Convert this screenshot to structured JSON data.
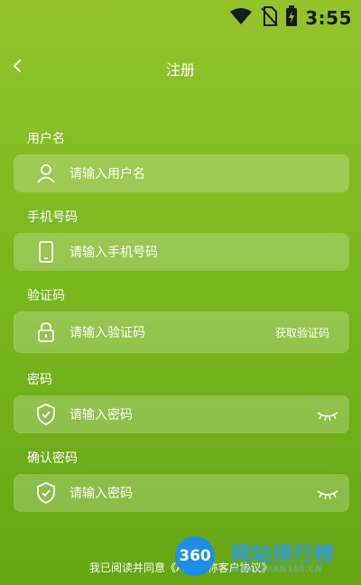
{
  "status": {
    "time": "3:55"
  },
  "header": {
    "title": "注册"
  },
  "fields": [
    {
      "label": "用户名",
      "placeholder": "请输入用户名"
    },
    {
      "label": "手机号码",
      "placeholder": "请输入手机号码"
    },
    {
      "label": "验证码",
      "placeholder": "请输入验证码",
      "action": "获取验证码"
    },
    {
      "label": "密码",
      "placeholder": "请输入密码"
    },
    {
      "label": "确认密码",
      "placeholder": "请输入密码"
    }
  ],
  "footer": {
    "agreement": "我已阅读并同意《APP名称客户协议》"
  },
  "watermark": {
    "badge": "360",
    "text": "网站排行榜",
    "sub": "WANGZHAN360.CN"
  },
  "colors": {
    "accent": "#7ab81f",
    "field_bg": "rgba(255,255,255,0.22)"
  }
}
